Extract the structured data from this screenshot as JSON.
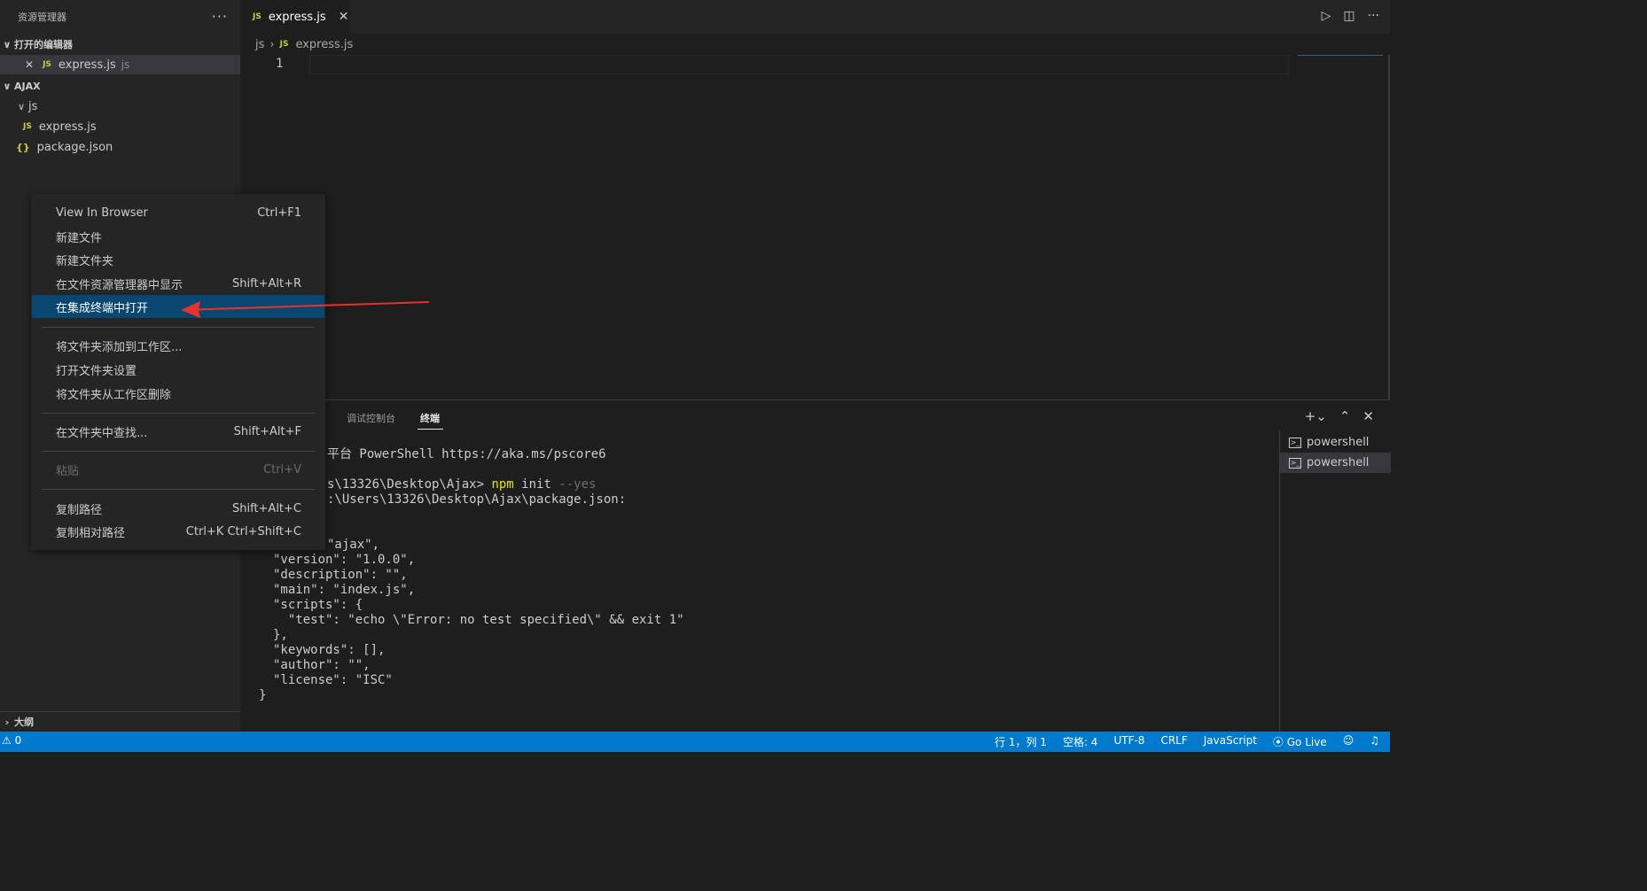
{
  "sidebar": {
    "title": "资源管理器",
    "more": "···",
    "open_editors": {
      "label": "打开的编辑器",
      "item": {
        "icon": "JS",
        "name": "express.js",
        "folder": "js"
      }
    },
    "workspace": {
      "label": "AJAX",
      "items": [
        {
          "name": "js",
          "type": "folder"
        },
        {
          "name": "express.js",
          "icon": "JS"
        },
        {
          "name": "package.json",
          "icon": "{}"
        }
      ]
    },
    "outline_label": "大纲"
  },
  "editor": {
    "tab": {
      "icon": "JS",
      "name": "express.js",
      "close": "✕"
    },
    "breadcrumb": {
      "folder": "js",
      "icon": "JS",
      "file": "express.js"
    },
    "line_number": "1"
  },
  "panel": {
    "tabs": {
      "debug": "调试控制台",
      "terminal": "终端"
    },
    "terminal_lines": [
      {
        "text": "平台 PowerShell https://aka.ms/pscore6"
      },
      {
        "prefix": "s\\13326\\Desktop\\Ajax> ",
        "cmd": "npm",
        "arg": " init ",
        "flag": "--yes"
      },
      {
        "text": ":\\Users\\13326\\Desktop\\Ajax\\package.json:"
      },
      {
        "text": "\"ajax\","
      },
      {
        "text": "\"version\": \"1.0.0\","
      },
      {
        "text": "\"description\": \"\","
      },
      {
        "text": "\"main\": \"index.js\","
      },
      {
        "text": "\"scripts\": {"
      },
      {
        "text": "  \"test\": \"echo \\\"Error: no test specified\\\" && exit 1\""
      },
      {
        "text": "},"
      },
      {
        "text": "\"keywords\": [],"
      },
      {
        "text": "\"author\": \"\","
      },
      {
        "text": "\"license\": \"ISC\""
      },
      {
        "text": "}"
      }
    ],
    "terminals": [
      "powershell",
      "powershell"
    ]
  },
  "context_menu": {
    "items": [
      {
        "label": "View In Browser",
        "shortcut": "Ctrl+F1"
      },
      {
        "label": "新建文件",
        "shortcut": ""
      },
      {
        "label": "新建文件夹",
        "shortcut": ""
      },
      {
        "label": "在文件资源管理器中显示",
        "shortcut": "Shift+Alt+R"
      },
      {
        "label": "在集成终端中打开",
        "shortcut": ""
      },
      {
        "label": "将文件夹添加到工作区...",
        "shortcut": ""
      },
      {
        "label": "打开文件夹设置",
        "shortcut": ""
      },
      {
        "label": "将文件夹从工作区删除",
        "shortcut": ""
      },
      {
        "label": "在文件夹中查找...",
        "shortcut": "Shift+Alt+F"
      },
      {
        "label": "粘贴",
        "shortcut": "Ctrl+V"
      },
      {
        "label": "复制路径",
        "shortcut": "Shift+Alt+C"
      },
      {
        "label": "复制相对路径",
        "shortcut": "Ctrl+K Ctrl+Shift+C"
      }
    ]
  },
  "statusbar": {
    "problems": "0",
    "position": "行 1，列 1",
    "spaces": "空格: 4",
    "encoding": "UTF-8",
    "eol": "CRLF",
    "language": "JavaScript",
    "golive": "Go Live"
  },
  "colors": {
    "accent": "#007acc",
    "selection": "#094771",
    "arrow": "#e8312a"
  }
}
